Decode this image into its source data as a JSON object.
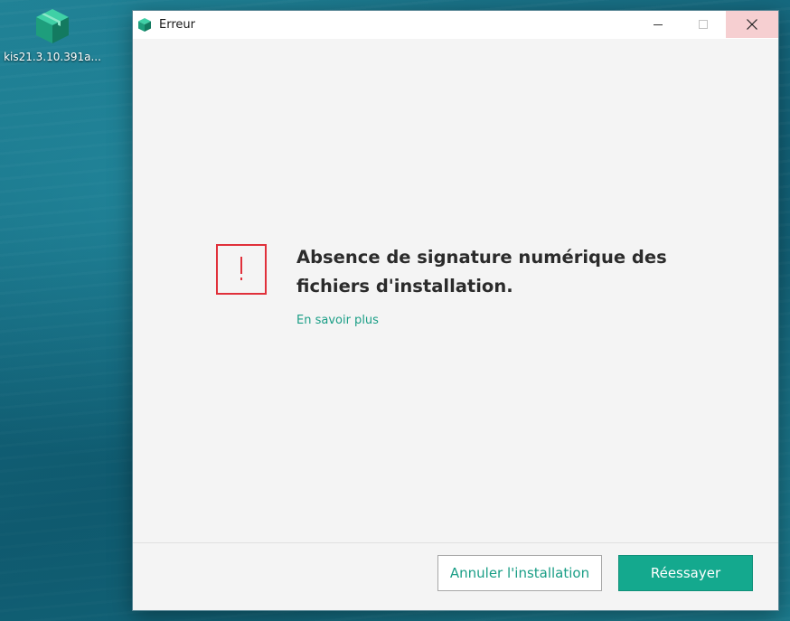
{
  "desktop": {
    "icon_name": "installer-package-icon",
    "icon_label": "kis21.3.10.391a..."
  },
  "window": {
    "title": "Erreur",
    "app_icon": "kaspersky-package-icon",
    "controls": {
      "minimize_icon": "minimize-icon",
      "maximize_icon": "maximize-icon",
      "close_icon": "close-icon"
    }
  },
  "error": {
    "icon": "exclamation-warning-icon",
    "headline": "Absence de signature numérique des fichiers d'installation.",
    "learn_more": "En savoir plus"
  },
  "footer": {
    "cancel_label": "Annuler l'installation",
    "retry_label": "Réessayer"
  },
  "colors": {
    "accent": "#14a98e",
    "link": "#1a9e86",
    "error": "#e0303a",
    "close_hover": "#f6cfd1"
  }
}
